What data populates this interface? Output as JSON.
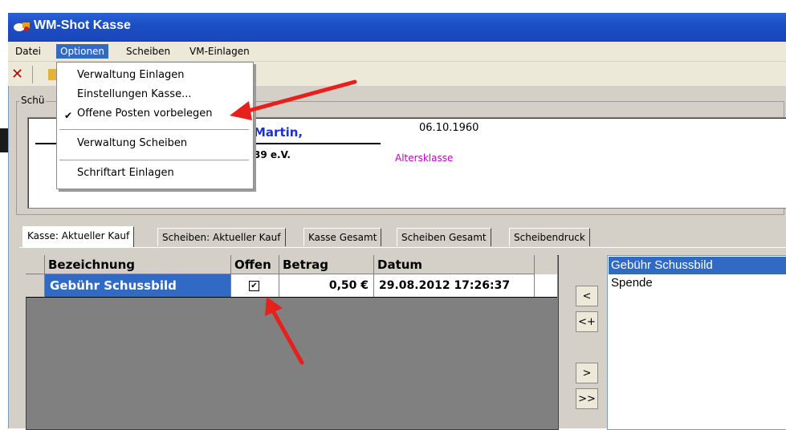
{
  "window": {
    "title": "WM-Shot Kasse"
  },
  "menubar": {
    "items": [
      "Datei",
      "Optionen",
      "Scheiben",
      "VM-Einlagen"
    ]
  },
  "dropdown": {
    "items": [
      {
        "label": "Verwaltung Einlagen",
        "checked": false
      },
      {
        "label": "Einstellungen Kasse...",
        "checked": false
      },
      {
        "label": "Offene Posten vorbelegen",
        "checked": true
      },
      {
        "label": "Verwaltung Scheiben",
        "checked": false
      },
      {
        "label": "Schriftart Einlagen",
        "checked": false
      }
    ],
    "check_glyph": "✔"
  },
  "group": {
    "legend": "Schü"
  },
  "shooter": {
    "name": "Martin,",
    "date": "06.10.1960",
    "club": "39 e.V.",
    "class_label": "Altersklasse"
  },
  "tabs": [
    "Kasse: Aktueller Kauf",
    "Scheiben: Aktueller Kauf",
    "Kasse Gesamt",
    "Scheiben Gesamt",
    "Scheibendruck"
  ],
  "grid": {
    "columns": [
      "Bezeichnung",
      "Offen",
      "Betrag",
      "Datum"
    ],
    "rows": [
      {
        "bezeichnung": "Gebühr Schussbild",
        "offen": true,
        "betrag": "0,50 €",
        "datum": "29.08.2012 17:26:37"
      }
    ]
  },
  "nav_buttons": [
    "<",
    "<+",
    ">",
    ">>"
  ],
  "list": {
    "items": [
      "Gebühr Schussbild",
      "Spende"
    ],
    "selected_index": 0
  },
  "colors": {
    "selection": "#316ac5",
    "titlebar": "#1c4fc4",
    "annotation_arrow": "#e8201b",
    "name_blue": "#1e2fd6",
    "class_magenta": "#c000c0"
  }
}
